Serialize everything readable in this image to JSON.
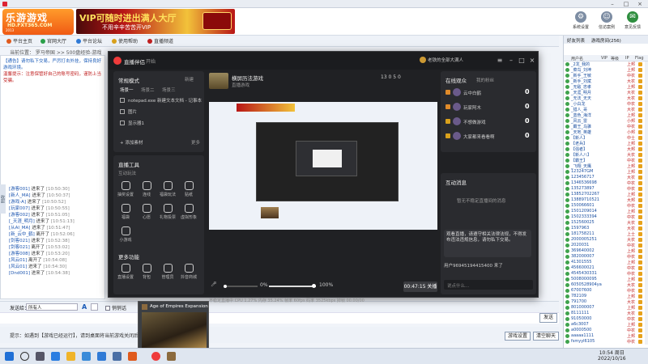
{
  "host": {
    "title": "",
    "logo": {
      "main": "乐游游戏",
      "url": "HD.FXT365.COM",
      "year": "2013"
    },
    "vip_banner": {
      "line1": "VIP可随时进出满人大厅",
      "line2": "不用辛辛苦苦开VIP",
      "stamp": ""
    },
    "toolbar": [
      {
        "label": "系统设置",
        "icon": "gear-icon"
      },
      {
        "label": "信访案例",
        "icon": "person-icon"
      },
      {
        "label": "意见反馈",
        "icon": "chat-icon"
      },
      {
        "label": "退出大厅",
        "icon": "exit-icon"
      }
    ],
    "nav": [
      {
        "label": "平台主页",
        "color": "#e05a1c"
      },
      {
        "label": "官网大厅",
        "color": "#2aa04a"
      },
      {
        "label": "平台论坛",
        "color": "#2f7ad6"
      },
      {
        "label": "使用帮助",
        "color": "#d9a11c"
      },
      {
        "label": "直播频道",
        "color": "#c02020"
      }
    ],
    "breadcrumb": "当前位置： 罗马帝国 >> 500盘经验-游戏",
    "notice": [
      "【通告】请勿私下交易，严厉打击外挂，保持良好游戏环境。",
      "温馨提示：注意保管好自己的账号密码，谨防上当受骗。"
    ],
    "collapse_label": "收起",
    "chat_log": [
      {
        "name": "[游客001]",
        "text": "进来了",
        "time": "[10:50:30]"
      },
      {
        "name": "[新人_MA]",
        "text": "进来了",
        "time": "[10:50:37]"
      },
      {
        "name": "[游戏-A]",
        "text": "进来了",
        "time": "[10:50:52]"
      },
      {
        "name": "[玩家007]",
        "text": "进来了",
        "time": "[10:50:55]"
      },
      {
        "name": "[游客002]",
        "text": "进来了",
        "time": "[10:51:05]"
      },
      {
        "name": "[_天涯_明月]",
        "text": "进来了",
        "time": "[10:51:13]"
      },
      {
        "name": "[从AI_MA]",
        "text": "进来了",
        "time": "[10:51:47]"
      },
      {
        "name": "[新_云中_鹤]",
        "text": "离开了",
        "time": "[10:52:06]"
      },
      {
        "name": "[剑客021]",
        "text": "进来了",
        "time": "[10:52:38]"
      },
      {
        "name": "[剑客021]",
        "text": "离开了",
        "time": "[10:53:02]"
      },
      {
        "name": "[游客008]",
        "text": "进来了",
        "time": "[10:53:20]"
      },
      {
        "name": "[风云01]",
        "text": "离开了",
        "time": "[10:54:08]"
      },
      {
        "name": "[风云01]",
        "text": "进来了",
        "time": "[10:54:30]"
      },
      {
        "name": "[Dnd001]",
        "text": "进来了",
        "time": "[10:54:38]"
      }
    ],
    "input_bar": {
      "to_label": "发送给：",
      "to_value": "所有人",
      "font_btn": "A",
      "private_label": "悄悄话"
    },
    "send_label": "发送",
    "tip": "提示：如遇到【游戏已经运行】，请到桌面将当前游戏关闭后再进入",
    "btn_room": "游戏设置",
    "btn_clear": "清空聊天"
  },
  "right_panel": {
    "tabs": [
      "好友列表",
      "游戏房间(256)"
    ],
    "headers": [
      "用户名",
      "VIP",
      "等级",
      "IP",
      "Flag"
    ],
    "users": [
      {
        "name": "_2龙_我的",
        "level": "上邦"
      },
      {
        "name": "_菜鸟_刘坤",
        "level": "上邦"
      },
      {
        "name": "_新手_王敏",
        "level": "中农"
      },
      {
        "name": "_新手_刘斌",
        "level": "大农"
      },
      {
        "name": "_无敌_忠孝",
        "level": "上邦"
      },
      {
        "name": "_天涯_明月",
        "level": "大农"
      },
      {
        "name": "_无法_无天",
        "level": "大农"
      },
      {
        "name": "_小白龙",
        "level": "中农"
      },
      {
        "name": "_猎人_哥",
        "level": "大农"
      },
      {
        "name": "_蓝色_海洋",
        "level": "上邦"
      },
      {
        "name": "_风云_雷",
        "level": "小邦"
      },
      {
        "name": "_霸王_乌骓",
        "level": "中农"
      },
      {
        "name": "_天地_英雄",
        "level": "小邦"
      },
      {
        "name": "【新人】",
        "level": "中士"
      },
      {
        "name": "【老兵】",
        "level": "上邦"
      },
      {
        "name": "【强者】",
        "level": "大邦"
      },
      {
        "name": "【新人八】",
        "level": "大农"
      },
      {
        "name": "【霸王】",
        "level": "中农"
      },
      {
        "name": "_飞翔_天鹰",
        "level": "上邦"
      },
      {
        "name": "123247GM",
        "level": "上邦"
      },
      {
        "name": "123456717",
        "level": "大农"
      },
      {
        "name": "1346536698",
        "level": "中农"
      },
      {
        "name": "135273897",
        "level": "中农"
      },
      {
        "name": "13852702267",
        "level": "上邦"
      },
      {
        "name": "13889710521",
        "level": "大邦"
      },
      {
        "name": "150066601",
        "level": "中农"
      },
      {
        "name": "1501209014",
        "level": "上邦"
      },
      {
        "name": "1502333394",
        "level": "中农"
      },
      {
        "name": "152560025",
        "level": "大农"
      },
      {
        "name": "1597963",
        "level": "大农"
      },
      {
        "name": "181758211",
        "level": "上士"
      },
      {
        "name": "2000005251",
        "level": "大农"
      },
      {
        "name": "2020031",
        "level": "中农"
      },
      {
        "name": "369640002",
        "level": "上邦"
      },
      {
        "name": "382000007",
        "level": "中农"
      },
      {
        "name": "41301555",
        "level": "上邦"
      },
      {
        "name": "456600021",
        "level": "中农"
      },
      {
        "name": "4545430331",
        "level": "中农"
      },
      {
        "name": "5008000095",
        "level": "上邦"
      },
      {
        "name": "6050528904ya",
        "level": "大农"
      },
      {
        "name": "67007600",
        "level": "中农"
      },
      {
        "name": "782109",
        "level": "上邦"
      },
      {
        "name": "791700",
        "level": "大农"
      },
      {
        "name": "801000007",
        "level": "上邦"
      },
      {
        "name": "8111111",
        "level": "大农"
      },
      {
        "name": "91050000",
        "level": "中农"
      },
      {
        "name": "a6c3007",
        "level": "上邦"
      },
      {
        "name": "a0000500",
        "level": "中农"
      },
      {
        "name": "aaaaa1111",
        "level": "上邦"
      },
      {
        "name": "fsmyyl6105",
        "level": "中农"
      }
    ]
  },
  "stream": {
    "app_name": "直播伴侣",
    "mode": "开始",
    "user": "老铁的全部大满人",
    "left": {
      "scene_title": "常规模式",
      "scene_sub": "新建",
      "scene_tabs": [
        "场景一",
        "场景二",
        "场景三"
      ],
      "sources": [
        "notepad.exe 新建文本文档 - 记事本",
        "图片",
        "显示器1"
      ],
      "add_source": "+ 添加素材",
      "add_sub": "更多",
      "tools_title": "直播工具",
      "tools_sub": "互动玩法",
      "tools": [
        "抽奖设置",
        "连线",
        "福袋玩法",
        "贴纸",
        "福袋",
        "心愿",
        "礼物投票",
        "虚拟形象",
        "小游戏"
      ],
      "more_title": "更多功能",
      "more": [
        "直播设置",
        "背包",
        "管理员",
        "抖音商城"
      ]
    },
    "center": {
      "room_title": "横屏历法游戏",
      "room_category": "直播游戏",
      "stats": "13  0  5  0",
      "zoom": "0%",
      "zoom2": "100%",
      "live_label": "00:47:15 关播",
      "status": "不稳定直播中   CPU 1.27%  内存 35.24%  帧率 60fps  码率 3525kbps   掉帧 00.00/00"
    },
    "right": {
      "viewers_title": "在线观众",
      "viewers_sub": "我的粉丝",
      "viewers": [
        {
          "name": "云中白鹤",
          "count": "0",
          "rank_color": "#e08b2a"
        },
        {
          "name": "玩家阿木",
          "count": "0",
          "rank_color": "#e08b2a"
        },
        {
          "name": "不想做游戏",
          "count": "0",
          "rank_color": "#d9a11c"
        },
        {
          "name": "大家都来看看啊",
          "count": "0",
          "rank_color": "#d9a11c"
        }
      ],
      "interact_title": "互动消息",
      "interact_sub": "",
      "interact_empty": "暂无不稳定直播间的消息",
      "notice": "观看直播，请遵守相关法律法规，不得发布违法违规信息，请勿私下交易。",
      "join": "用户96945194415400 来了",
      "chat_placeholder": "说点什么..."
    }
  },
  "taskbar": {
    "time": "10:54 周日",
    "date": "2022/10/16"
  },
  "tooltip": {
    "title": "Age of Empires Expansion"
  }
}
